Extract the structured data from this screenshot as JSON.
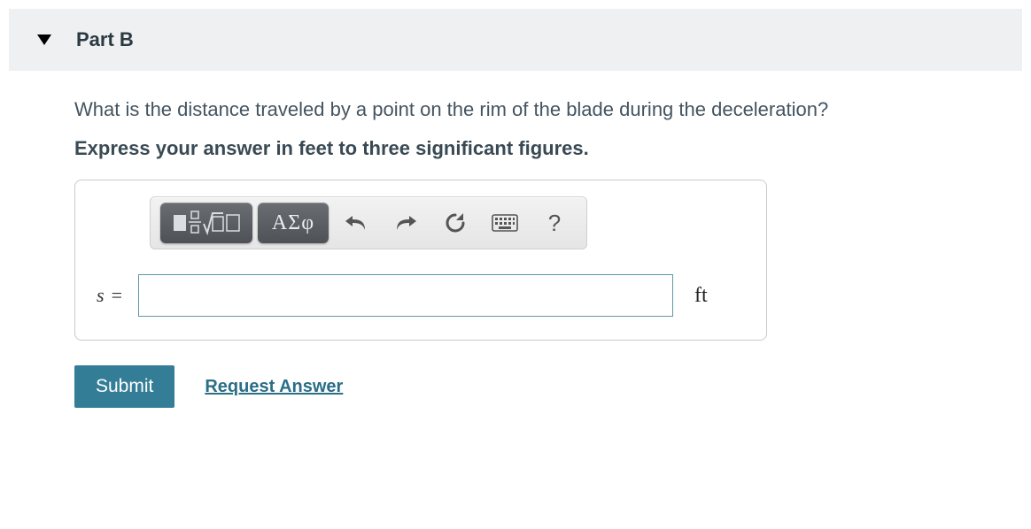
{
  "part": {
    "title": "Part B"
  },
  "question": "What is the distance traveled by a point on the rim of the blade during the deceleration?",
  "instruction": "Express your answer in feet to three significant figures.",
  "toolbar": {
    "templates_icon": "math-templates-icon",
    "greek_label": "ΑΣφ",
    "undo_icon": "undo-icon",
    "redo_icon": "redo-icon",
    "reset_icon": "reset-icon",
    "keyboard_icon": "keyboard-icon",
    "help_label": "?"
  },
  "answer": {
    "variable": "s",
    "equals": "=",
    "value": "",
    "unit": "ft"
  },
  "actions": {
    "submit_label": "Submit",
    "request_label": "Request Answer"
  }
}
